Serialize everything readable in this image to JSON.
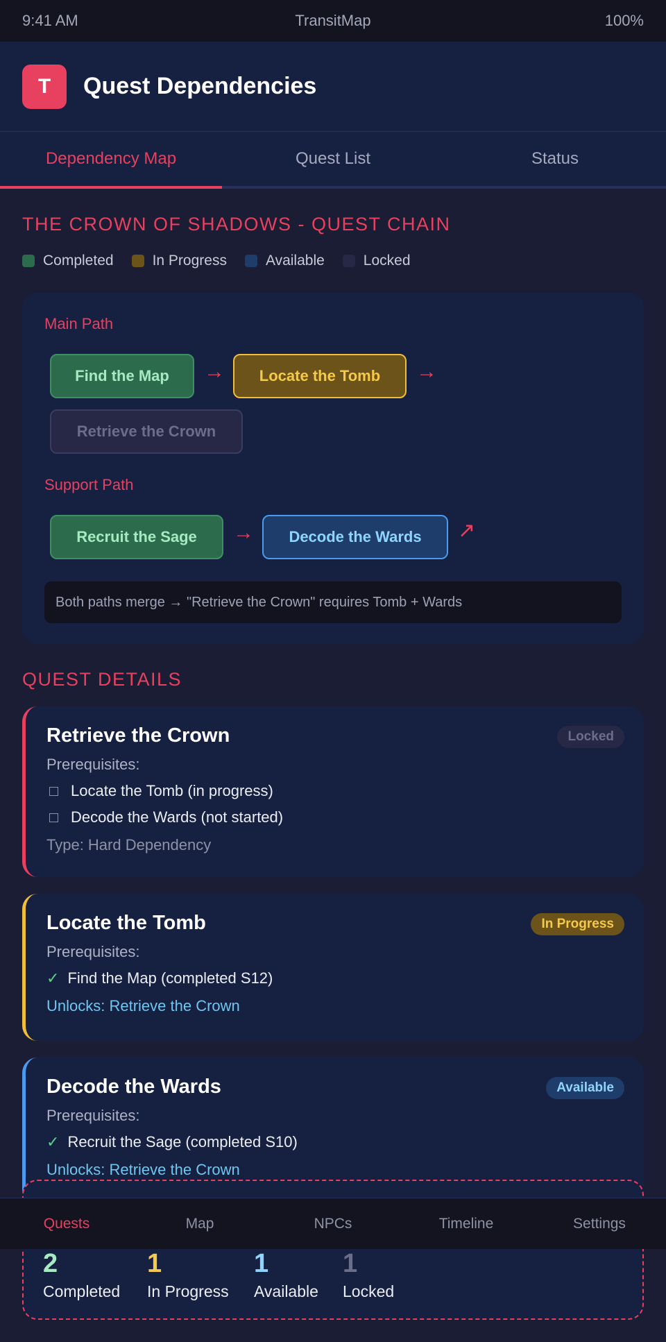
{
  "status_bar": {
    "time": "9:41 AM",
    "title": "TransitMap",
    "battery": "100%"
  },
  "header": {
    "logo_letter": "T",
    "title": "Quest Dependencies"
  },
  "tabs": [
    {
      "label": "Dependency Map",
      "active": true
    },
    {
      "label": "Quest List",
      "active": false
    },
    {
      "label": "Status",
      "active": false
    }
  ],
  "chain_title": "THE CROWN OF SHADOWS - QUEST CHAIN",
  "legend": [
    {
      "label": "Completed",
      "color": "#2d6b4d"
    },
    {
      "label": "In Progress",
      "color": "#6b531a"
    },
    {
      "label": "Available",
      "color": "#1f3d6a"
    },
    {
      "label": "Locked",
      "color": "#262845"
    }
  ],
  "map": {
    "main_path_label": "Main Path",
    "main_nodes": [
      "Find the Map",
      "Locate the Tomb",
      "Retrieve the Crown"
    ],
    "support_path_label": "Support Path",
    "support_nodes": [
      "Recruit the Sage",
      "Decode the Wards"
    ],
    "arrow_glyph": "→",
    "merge_glyph": "↗",
    "merge_note": "Both paths merge → \"Retrieve the Crown\" requires Tomb + Wards"
  },
  "details_title": "QUEST DETAILS",
  "quests": [
    {
      "title": "Retrieve the Crown",
      "badge": "Locked",
      "prereq_label": "Prerequisites:",
      "prereqs": [
        "Locate the Tomb (in progress)",
        "Decode the Wards (not started)"
      ],
      "meta": "Type: Hard Dependency"
    },
    {
      "title": "Locate the Tomb",
      "badge": "In Progress",
      "prereq_label": "Prerequisites:",
      "prereqs": [
        "Find the Map (completed S12)"
      ],
      "meta": "Unlocks: Retrieve the Crown"
    },
    {
      "title": "Decode the Wards",
      "badge": "Available",
      "prereq_label": "Prerequisites:",
      "prereqs": [
        "Recruit the Sage (completed S10)"
      ],
      "meta": "Unlocks: Retrieve the Crown"
    }
  ],
  "check_glyph": "✓",
  "summary": [
    {
      "value": "2",
      "label": "Completed",
      "color": "#a7eac1"
    },
    {
      "value": "1",
      "label": "In Progress",
      "color": "#f5c94a"
    },
    {
      "value": "1",
      "label": "Available",
      "color": "#8fd4ff"
    },
    {
      "value": "1",
      "label": "Locked",
      "color": "#6a6e88"
    }
  ],
  "bottom_nav": [
    {
      "label": "Quests",
      "active": true
    },
    {
      "label": "Map",
      "active": false
    },
    {
      "label": "NPCs",
      "active": false
    },
    {
      "label": "Timeline",
      "active": false
    },
    {
      "label": "Settings",
      "active": false
    }
  ]
}
